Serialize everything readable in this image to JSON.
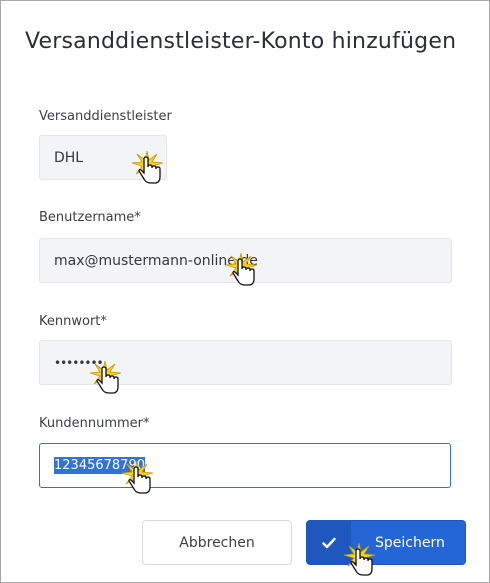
{
  "dialog": {
    "title": "Versanddienstleister-Konto hinzufügen"
  },
  "form": {
    "carrier": {
      "label": "Versanddienstleister",
      "value": "DHL"
    },
    "username": {
      "label": "Benutzername*",
      "value": "max@mustermann-online.de"
    },
    "password": {
      "label": "Kennwort*",
      "value": "••••••••"
    },
    "customer_number": {
      "label": "Kundennummer*",
      "value": "12345678790"
    }
  },
  "buttons": {
    "cancel_label": "Abbrechen",
    "save_label": "Speichern",
    "save_icon": "check-icon"
  },
  "colors": {
    "primary": "#2566d6",
    "selection": "#2f73d8",
    "field_bg": "#f3f4f7"
  }
}
